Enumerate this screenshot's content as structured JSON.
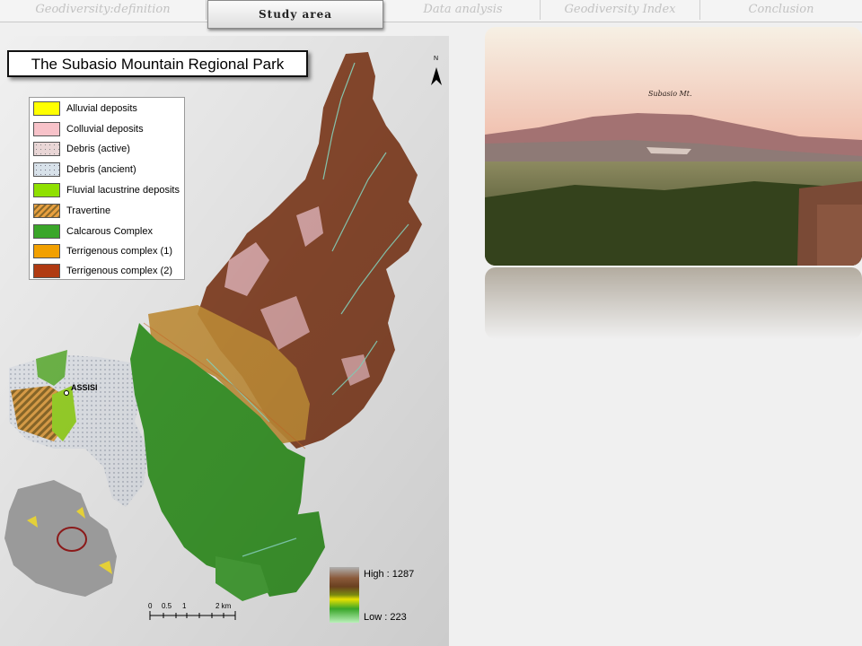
{
  "nav": {
    "tabs": [
      {
        "label": "Geodiversity:definition"
      },
      {
        "label": "Data analysis"
      },
      {
        "label": "Geodiversity Index"
      },
      {
        "label": "Conclusion"
      }
    ],
    "active_tab": "Study area"
  },
  "main": {
    "title": "The Subasio Mountain Regional Park",
    "town_label": "ASSISI",
    "north_label": "N"
  },
  "legend": {
    "items": [
      {
        "label": "Alluvial deposits",
        "color": "#ffff00"
      },
      {
        "label": "Colluvial deposits",
        "color": "#f7c2c9"
      },
      {
        "label": "Debris (active)",
        "color": "#e9d6d6"
      },
      {
        "label": "Debris (ancient)",
        "color": "#d8e2ea"
      },
      {
        "label": "Fluvial lacustrine deposits",
        "color": "#8fe000"
      },
      {
        "label": "Travertine",
        "color": "#e8a040"
      },
      {
        "label": "Calcarous Complex",
        "color": "#3aa629"
      },
      {
        "label": "Terrigenous complex (1)",
        "color": "#f2a000"
      },
      {
        "label": "Terrigenous complex (2)",
        "color": "#b03a12"
      }
    ]
  },
  "elevation": {
    "high_label": "High : 1287",
    "low_label": "Low : 223"
  },
  "scale": {
    "ticks": [
      "0",
      "0.5",
      "1",
      "2 km"
    ]
  },
  "photo": {
    "caption": "Subasio Mt."
  }
}
